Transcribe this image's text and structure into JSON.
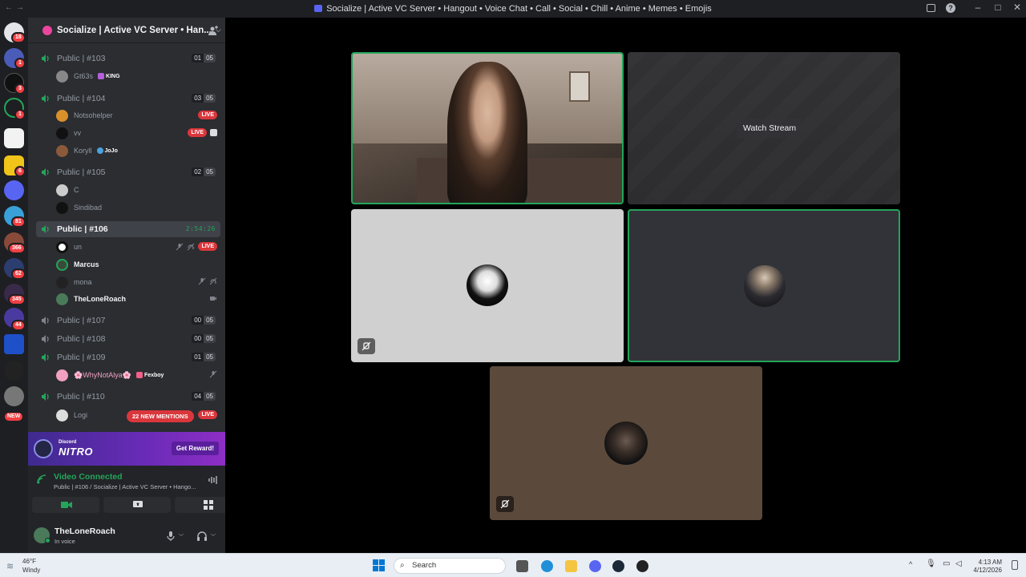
{
  "window": {
    "title": "Socialize | Active VC Server • Hangout • Voice Chat • Call • Social • Chill • Anime • Memes • Emojis"
  },
  "servers": [
    {
      "badge": "18"
    },
    {
      "badge": "1"
    },
    {
      "badge": "3"
    },
    {
      "badge": "1"
    },
    {
      "badge": ""
    },
    {
      "badge": "6"
    },
    {
      "badge": ""
    },
    {
      "badge": "81"
    },
    {
      "badge": "366"
    },
    {
      "badge": "62"
    },
    {
      "badge": "345"
    },
    {
      "badge": "44"
    },
    {
      "badge": ""
    },
    {
      "badge": ""
    },
    {
      "badge": "NEW"
    }
  ],
  "server_header": {
    "name": "Socialize | Active VC Server • Han..."
  },
  "channels": [
    {
      "name": "Public | #103",
      "c1": "01",
      "c2": "05"
    },
    {
      "name": "Public | #104",
      "c1": "03",
      "c2": "05"
    },
    {
      "name": "Public | #105",
      "c1": "02",
      "c2": "05"
    },
    {
      "name": "Public | #106",
      "timer": "2:54:26"
    },
    {
      "name": "Public | #107",
      "c1": "00",
      "c2": "05"
    },
    {
      "name": "Public | #108",
      "c1": "00",
      "c2": "05"
    },
    {
      "name": "Public | #109",
      "c1": "01",
      "c2": "05"
    },
    {
      "name": "Public | #110",
      "c1": "04",
      "c2": "05"
    }
  ],
  "members": {
    "gt63s": {
      "name": "Gt63s",
      "tag": "KING"
    },
    "notsohelper": {
      "name": "Notsohelper",
      "live": "LIVE"
    },
    "vv": {
      "name": "vv",
      "live": "LIVE"
    },
    "koryll": {
      "name": "Koryll",
      "tag": "JoJo"
    },
    "c": {
      "name": "C"
    },
    "sindibad": {
      "name": "Sindibad"
    },
    "un": {
      "name": "un",
      "live": "LIVE"
    },
    "marcus": {
      "name": "Marcus"
    },
    "mona": {
      "name": "mona"
    },
    "theloneroach": {
      "name": "TheLoneRoach"
    },
    "whynotalya": {
      "name": "🌸WhyNotAlya🌸",
      "tag": "Fexboy"
    },
    "logi": {
      "name": "Logi",
      "live": "LIVE"
    }
  },
  "mentions": "22 NEW MENTIONS",
  "nitro": {
    "small": "Discord",
    "big": "NITRO",
    "button": "Get Reward!"
  },
  "voice": {
    "status": "Video Connected",
    "channel": "Public | #106 / Socialize | Active VC Server • Hango..."
  },
  "user": {
    "name": "TheLoneRoach",
    "status": "In voice"
  },
  "stream": {
    "watch_label": "Watch Stream"
  },
  "taskbar": {
    "temp": "46°F",
    "weather": "Windy",
    "search": "Search",
    "time": "4:13 AM",
    "date": "4/12/2026"
  },
  "colors": {
    "accent": "#5865f2",
    "speaking": "#23a55a",
    "live": "#da373c",
    "nitro": "#6a2bb8"
  }
}
